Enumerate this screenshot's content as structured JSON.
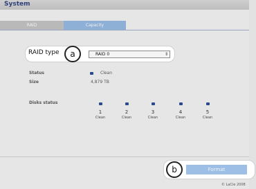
{
  "header": {
    "title": "System"
  },
  "tabs": [
    {
      "label": "RAID"
    },
    {
      "label": "Capacity"
    }
  ],
  "raid": {
    "label": "RAID type",
    "callout_badge": "a",
    "selected": "RAID 0"
  },
  "status": {
    "label": "Status",
    "value": "Clean"
  },
  "size": {
    "label": "Size",
    "value": "4,879 TB"
  },
  "disks": {
    "label": "Disks status",
    "items": [
      {
        "number": "1",
        "status": "Clean"
      },
      {
        "number": "2",
        "status": "Clean"
      },
      {
        "number": "3",
        "status": "Clean"
      },
      {
        "number": "4",
        "status": "Clean"
      },
      {
        "number": "5",
        "status": "Clean"
      }
    ]
  },
  "format": {
    "callout_badge": "b",
    "button_label": "Format"
  },
  "footer": {
    "copyright": "© LaCie 2008"
  },
  "colors": {
    "accent": "#8fb0d6",
    "button": "#9dbfe5",
    "led": "#2b4a8a",
    "title": "#2f3f79"
  }
}
